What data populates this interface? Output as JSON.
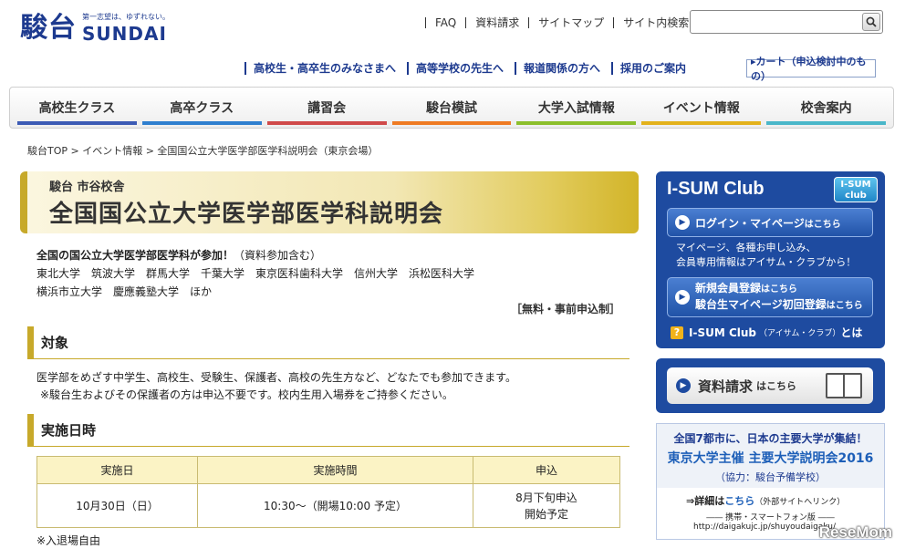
{
  "logo": {
    "kanji": "駿台",
    "english": "SUNDAI",
    "tagline": "第一志望は、ゆずれない。"
  },
  "util_nav": {
    "faq": "FAQ",
    "request": "資料請求",
    "sitemap": "サイトマップ",
    "search_label": "サイト内検索:"
  },
  "sub_nav": [
    "高校生・高卒生のみなさまへ",
    "高等学校の先生へ",
    "報道関係の方へ",
    "採用のご案内"
  ],
  "cart": "▸カート（申込検討中のもの）",
  "global_nav": [
    {
      "label": "高校生クラス",
      "color": "#3c5bb5"
    },
    {
      "label": "高卒クラス",
      "color": "#2f7fcf"
    },
    {
      "label": "講習会",
      "color": "#d04a4a"
    },
    {
      "label": "駿台模試",
      "color": "#ef7b23"
    },
    {
      "label": "大学入試情報",
      "color": "#8cbf2c"
    },
    {
      "label": "イベント情報",
      "color": "#e3b21c"
    },
    {
      "label": "校舎案内",
      "color": "#4ab7c9"
    }
  ],
  "breadcrumb": "駿台TOP > イベント情報 > 全国国公立大学医学部医学科説明会（東京会場）",
  "event": {
    "subtitle": "駿台 市谷校舎",
    "title": "全国国公立大学医学部医学科説明会",
    "lead": "全国の国公立大学医学部医学科が参加！",
    "lead_note": "（資料参加含む）",
    "universities_line1": "東北大学　筑波大学　群馬大学　千葉大学　東京医科歯科大学　信州大学　浜松医科大学",
    "universities_line2": "横浜市立大学　慶應義塾大学　ほか",
    "fee": "［無料・事前申込制］"
  },
  "target": {
    "heading": "対象",
    "text": "医学部をめざす中学生、高校生、受験生、保護者、高校の先生方など、どなたでも参加できます。",
    "note": "※駿台生およびその保護者の方は申込不要です。校内生用入場券をご持参ください。"
  },
  "schedule": {
    "heading": "実施日時",
    "headers": [
      "実施日",
      "実施時間",
      "申込"
    ],
    "row": {
      "date": "10月30日（日）",
      "time": "10:30～（開場10:00 予定）",
      "apply_line1": "8月下旬申込",
      "apply_line2": "開始予定"
    },
    "note": "※入退場自由"
  },
  "isum": {
    "title": "I-SUM Club",
    "badge": "I-SUM club",
    "login_main": "ログイン・マイページ",
    "login_small": "はこちら",
    "desc_line1": "マイページ、各種お申し込み、",
    "desc_line2": "会員専用情報はアイサム・クラブから！",
    "register_line1_main": "新規会員登録",
    "register_line1_small": "はこちら",
    "register_line2_main": "駿台生マイページ初回登録",
    "register_line2_small": "はこちら",
    "help_main": "I-SUM Club",
    "help_small": "（アイサム・クラブ）",
    "help_end": "とは"
  },
  "request_box": {
    "label": "資料請求",
    "small": "はこちら"
  },
  "promo": {
    "line1": "全国7都市に、日本の主要大学が集結！",
    "line2": "東京大学主催 主要大学説明会2016",
    "line3": "（協力：駿台予備学校）",
    "detail": "⇒詳細は",
    "link": "こちら",
    "detail_small": "（外部サイトへリンク）",
    "sub": "―― 携帯・スマートフォン版 ――",
    "url": "http://daigakujc.jp/shuyoudaigaku/"
  },
  "watermark": "ReseMom"
}
